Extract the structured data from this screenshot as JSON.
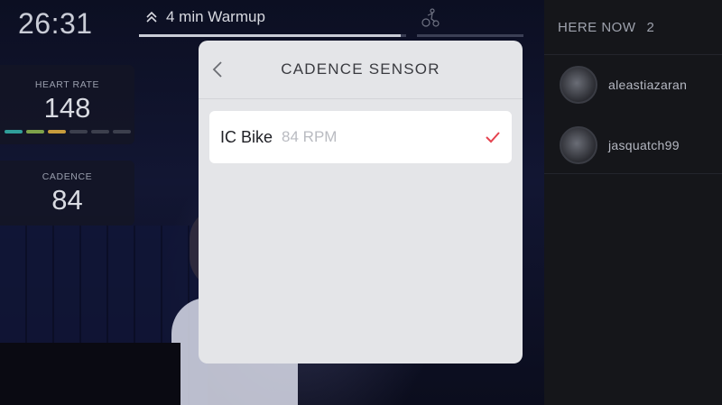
{
  "workout": {
    "timer": "26:31",
    "segment_label": "4 min Warmup",
    "segment_progress": 0.98
  },
  "metrics": {
    "heart_rate": {
      "label": "HEART RATE",
      "value": "148"
    },
    "cadence": {
      "label": "CADENCE",
      "value": "84"
    },
    "zone_colors": [
      "#2f9f9a",
      "#7ea24a",
      "#c79c3c",
      "#3c3f4d",
      "#3c3f4d",
      "#3c3f4d"
    ]
  },
  "here_now": {
    "title": "HERE NOW",
    "count": "2",
    "users": [
      {
        "name": "aleastiazaran"
      },
      {
        "name": "jasquatch99"
      }
    ]
  },
  "modal": {
    "title": "CADENCE SENSOR",
    "back_icon": "chevron-left-icon",
    "sensors": [
      {
        "name": "IC Bike",
        "reading": "84 RPM",
        "selected": true
      }
    ],
    "accent_color": "#e5434f"
  }
}
